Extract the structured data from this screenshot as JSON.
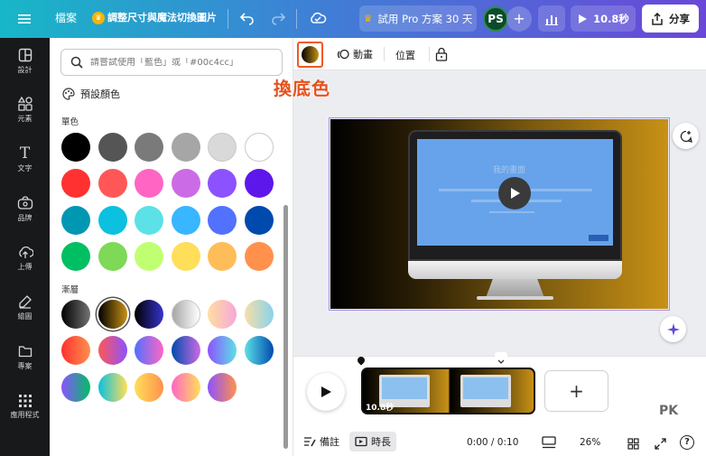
{
  "topbar": {
    "menu_icon": "hamburger-icon",
    "file": "檔案",
    "resize": "調整尺寸與魔法切換圖片",
    "undo_icon": "undo-icon",
    "redo_icon": "redo-icon",
    "cloud_icon": "cloud-save-icon",
    "trial": "試用 Pro 方案 30 天",
    "avatar": "PS",
    "play": "10.8秒",
    "share": "分享"
  },
  "rail": [
    {
      "icon": "design-icon",
      "label": "設計"
    },
    {
      "icon": "elements-icon",
      "label": "元素"
    },
    {
      "icon": "text-icon",
      "label": "文字"
    },
    {
      "icon": "brand-icon",
      "label": "品牌"
    },
    {
      "icon": "upload-icon",
      "label": "上傳"
    },
    {
      "icon": "draw-icon",
      "label": "繪圖"
    },
    {
      "icon": "projects-icon",
      "label": "專案"
    },
    {
      "icon": "apps-icon",
      "label": "應用程式"
    }
  ],
  "panel": {
    "search_placeholder": "請嘗試使用「藍色」或「#00c4cc」",
    "default_colors": "預設顏色",
    "solid_title": "單色",
    "gradient_title": "漸層",
    "solids": [
      "#000000",
      "#555555",
      "#7a7a7a",
      "#a6a6a6",
      "#d9d9d9",
      "#ffffff",
      "#ff3131",
      "#ff5757",
      "#ff66c4",
      "#cb6ce6",
      "#8c52ff",
      "#5e17eb",
      "#0097b2",
      "#0cc0df",
      "#5ce1e6",
      "#38b6ff",
      "#5271ff",
      "#004aad",
      "#00bf63",
      "#7ed957",
      "#c1ff72",
      "#ffde59",
      "#ffbd59",
      "#ff914d"
    ],
    "gradients": [
      [
        "#000000",
        "#737373"
      ],
      [
        "#000000",
        "#c89116"
      ],
      [
        "#000000",
        "#3533cd"
      ],
      [
        "#a6a6a6",
        "#ffffff"
      ],
      [
        "#ffdea2",
        "#f7a7d8"
      ],
      [
        "#f6dfa6",
        "#8ad2ee"
      ],
      [
        "#ff3131",
        "#ff914d"
      ],
      [
        "#ff5757",
        "#8c52ff"
      ],
      [
        "#5170ff",
        "#ff66c4"
      ],
      [
        "#004aad",
        "#cb6ce6"
      ],
      [
        "#8c52ff",
        "#5ce1e6"
      ],
      [
        "#5de0e6",
        "#004aad"
      ],
      [
        "#8c52ff",
        "#00bf63"
      ],
      [
        "#0cc0df",
        "#ffde59"
      ],
      [
        "#ffde59",
        "#ff914d"
      ],
      [
        "#ff66c4",
        "#ffde59"
      ],
      [
        "#8c52ff",
        "#ff914d"
      ]
    ]
  },
  "context": {
    "annotation": "換底色",
    "animate": "動畫",
    "position": "位置",
    "lock_icon": "lock-icon"
  },
  "canvas": {
    "bg_gradient": [
      "#000000",
      "#c89116"
    ],
    "screen_title": "我的畫面",
    "watermark": "PK"
  },
  "timeline": {
    "clip_duration": "10.8秒",
    "notes": "備註",
    "duration": "時長",
    "time": "0:00 / 0:10",
    "zoom": "26%"
  }
}
